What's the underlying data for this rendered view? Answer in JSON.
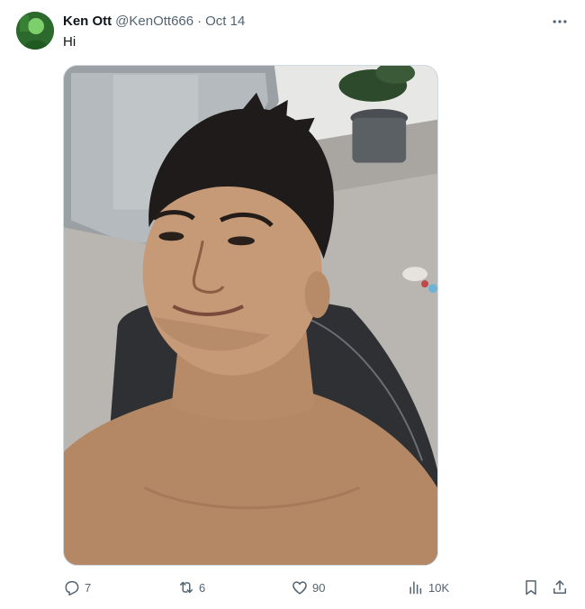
{
  "tweet": {
    "author": {
      "display_name": "Ken Ott",
      "handle": "@KenOtt666"
    },
    "separator": "·",
    "date": "Oct 14",
    "text": "Hi",
    "media": {
      "alt": "Selfie photo"
    }
  },
  "actions": {
    "reply": {
      "icon": "reply-icon",
      "count": "7"
    },
    "retweet": {
      "icon": "retweet-icon",
      "count": "6"
    },
    "like": {
      "icon": "heart-icon",
      "count": "90"
    },
    "views": {
      "icon": "bar-chart-icon",
      "count": "10K"
    },
    "bookmark": {
      "icon": "bookmark-icon"
    },
    "share": {
      "icon": "share-icon"
    }
  },
  "colors": {
    "text_primary": "#0f1419",
    "text_secondary": "#536471",
    "border": "#cfd9de"
  }
}
